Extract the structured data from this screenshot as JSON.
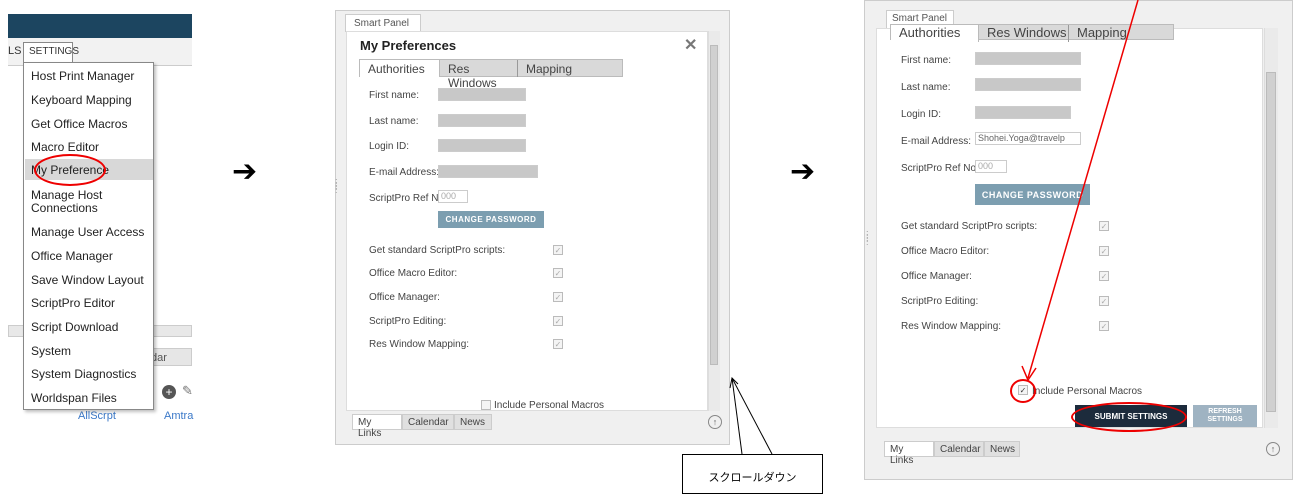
{
  "panel1": {
    "tools_label": "LS",
    "settings_tab": "SETTINGS",
    "menu_items": [
      "Host Print Manager",
      "Keyboard Mapping",
      "Get Office Macros",
      "Macro Editor",
      "My Preference",
      "Manage Host\nConnections",
      "Manage User Access",
      "Office Manager",
      "Save Window Layout",
      "ScriptPro Editor",
      "Script Download",
      "System",
      "System Diagnostics",
      "Worldspan Files"
    ],
    "lower_tab_fragment": "dar",
    "link_allscrpt": "AllScrpt",
    "link_amtra": "Amtra"
  },
  "panel2": {
    "smart_panel_tab": "Smart Panel",
    "title": "My Preferences",
    "close": "✕",
    "tabs": [
      "Authorities",
      "Res Windows",
      "Mapping"
    ],
    "fields": [
      "First name:",
      "Last name:",
      "Login ID:",
      "E-mail Address:",
      "ScriptPro Ref No:"
    ],
    "ref_placeholder": "000",
    "change_password": "CHANGE PASSWORD",
    "checkbox_labels": [
      "Get standard ScriptPro scripts:",
      "Office Macro Editor:",
      "Office Manager:",
      "ScriptPro Editing:",
      "Res Window Mapping:"
    ],
    "include_macros": "Include Personal Macros",
    "bottom_tabs": [
      "My Links",
      "Calendar",
      "News"
    ]
  },
  "callout_text": "スクロールダウン",
  "panel3": {
    "smart_panel_tab": "Smart Panel",
    "tabs": [
      "Authorities",
      "Res Windows",
      "Mapping"
    ],
    "fields": [
      "First name:",
      "Last name:",
      "Login ID:",
      "E-mail Address:",
      "ScriptPro Ref No:"
    ],
    "ref_placeholder": "000",
    "email_partial": "Shohei.Yoga@travelp",
    "change_password": "CHANGE PASSWORD",
    "checkbox_labels": [
      "Get standard ScriptPro scripts:",
      "Office Macro Editor:",
      "Office Manager:",
      "ScriptPro Editing:",
      "Res Window Mapping:"
    ],
    "include_macros": "Include Personal Macros",
    "submit": "SUBMIT SETTINGS",
    "refresh": "REFRESH SETTINGS",
    "bottom_tabs": [
      "My Links",
      "Calendar",
      "News"
    ]
  },
  "arrow": "➔",
  "colors": {
    "red_highlight": "#e00000",
    "header": "#1c4560",
    "button": "#7c9eb0",
    "submit": "#1c2b3c"
  }
}
